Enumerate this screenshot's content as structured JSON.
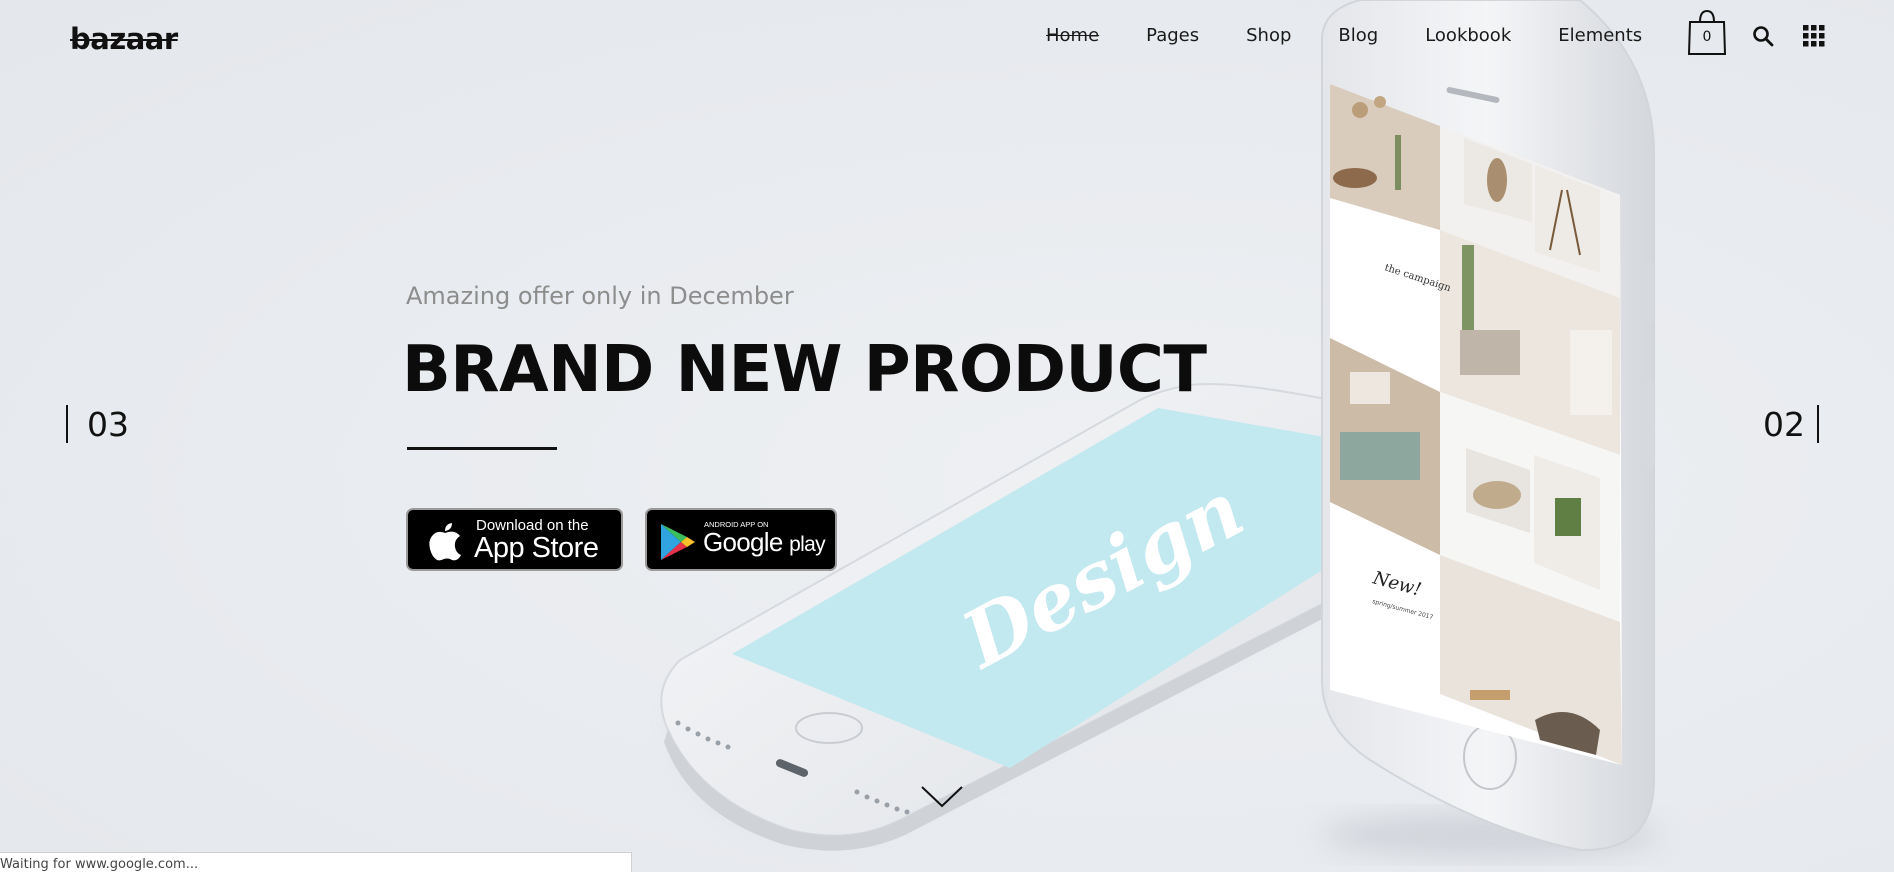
{
  "brand": {
    "logo": "bazaar"
  },
  "nav": {
    "items": [
      {
        "label": "Home",
        "active": true
      },
      {
        "label": "Pages"
      },
      {
        "label": "Shop"
      },
      {
        "label": "Blog"
      },
      {
        "label": "Lookbook"
      },
      {
        "label": "Elements"
      }
    ],
    "cart_count": "0",
    "icons": [
      "shopping-bag-icon",
      "search-icon",
      "grid-menu-icon"
    ]
  },
  "hero": {
    "subtitle": "Amazing offer only in December",
    "title": "BRAND NEW PRODUCT",
    "phone_screen_text": "Design",
    "buttons": {
      "app_store": {
        "small": "Download on the",
        "big": "App Store"
      },
      "google_play": {
        "small": "ANDROID APP ON",
        "big_a": "Google",
        "big_b": "play"
      }
    }
  },
  "slider": {
    "prev_number": "03",
    "next_number": "02"
  },
  "phone_lookbook": {
    "campaign_text": "the campaign",
    "new_text": "New!",
    "new_sub": "spring/summer 2017"
  },
  "status_bar": {
    "text": "Waiting for www.google.com..."
  },
  "colors": {
    "background": "#e8ebef",
    "screen_blue": "#c2e8f0",
    "text_dark": "#111111",
    "subtitle_gray": "#8d8d8d"
  }
}
